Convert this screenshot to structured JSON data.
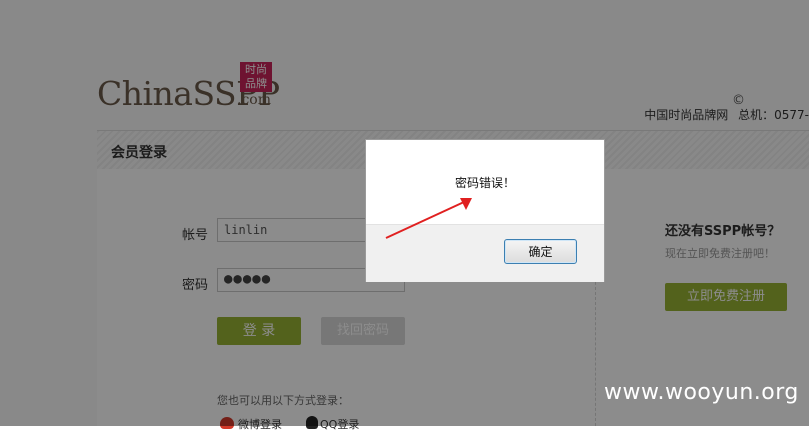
{
  "logo": {
    "text": "ChinaSSPP",
    "dotcom": ".com",
    "badge": "时尚品牌"
  },
  "header": {
    "site_name": "中国时尚品牌网",
    "hotline": "总机：0577-"
  },
  "panel": {
    "title": "会员登录",
    "account_label": "帐号",
    "account_value": "linlin",
    "password_label": "密码",
    "password_value": "●●●●●",
    "login_button": "登 录",
    "forgot_button": "找回密码",
    "alt_login_text": "您也可以用以下方式登录：",
    "weibo_label": "微博登录",
    "qq_label": "QQ登录"
  },
  "sidebar": {
    "title": "还没有SSPP帐号？",
    "subtitle": "现在立即免费注册吧！",
    "register_button": "立即免费注册"
  },
  "dialog": {
    "message": "密码错误！",
    "ok_button": "确定"
  },
  "watermark": "www.wooyun.org",
  "colors": {
    "accent_green": "#98b334",
    "logo_badge": "#c8245a",
    "arrow": "#e02020"
  }
}
